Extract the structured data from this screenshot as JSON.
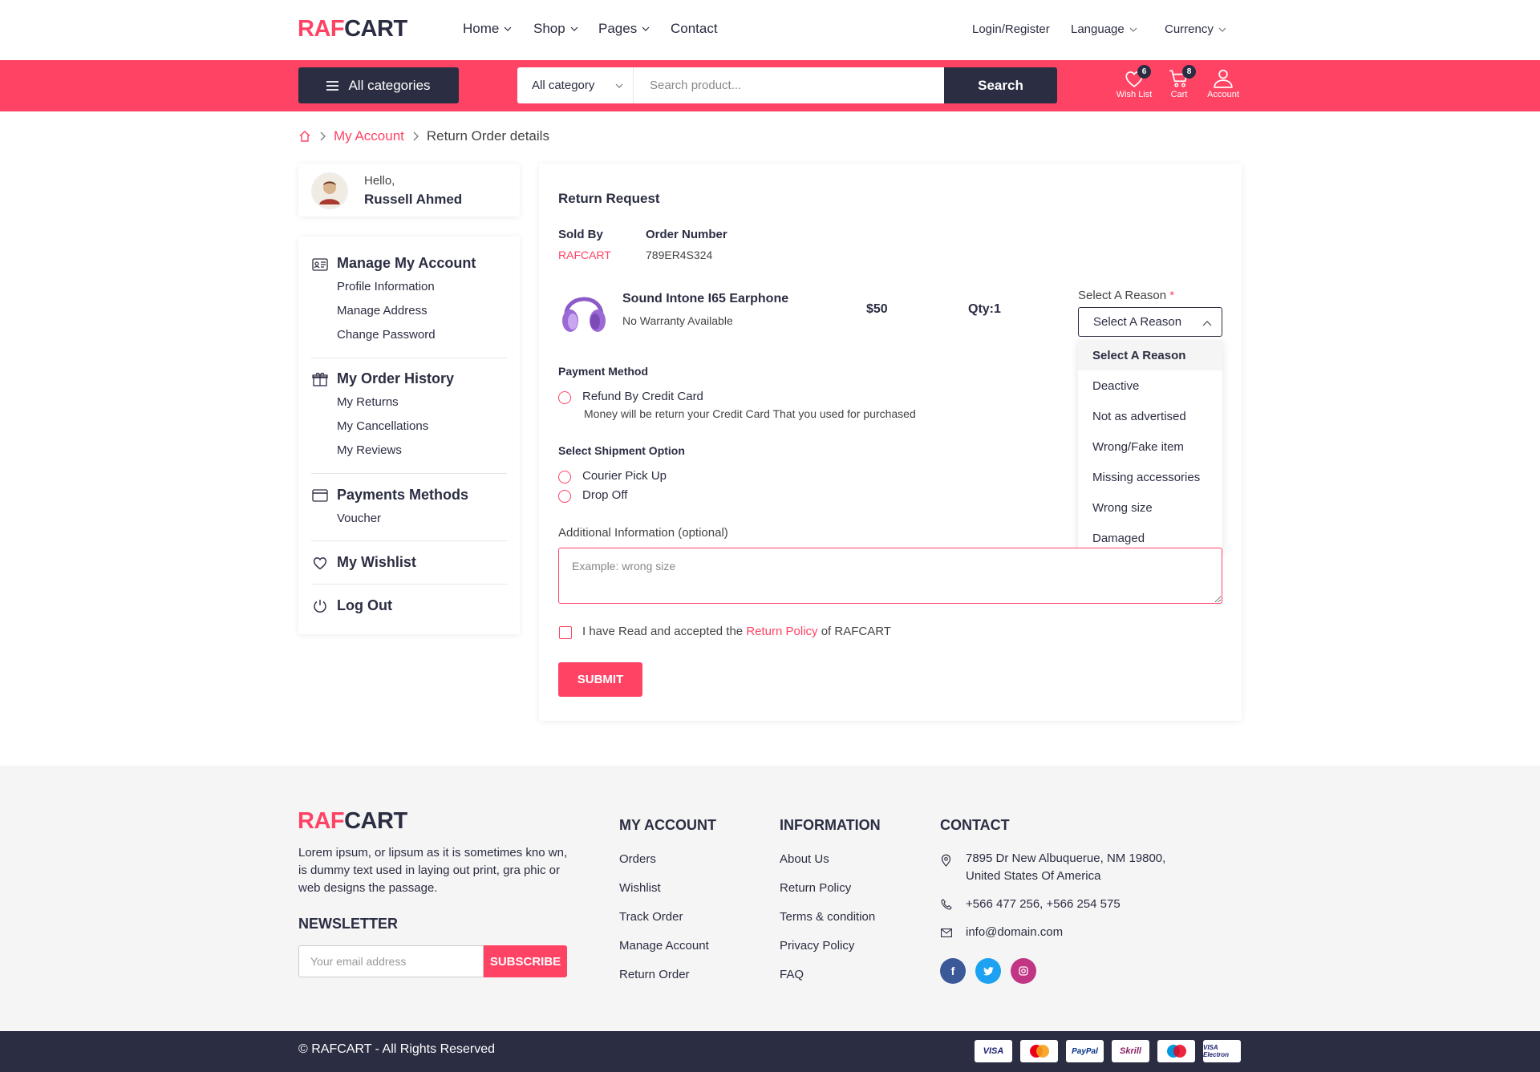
{
  "brand": {
    "part1": "RAF",
    "part2": "CART"
  },
  "nav": {
    "home": "Home",
    "shop": "Shop",
    "pages": "Pages",
    "contact": "Contact"
  },
  "util": {
    "login": "Login/Register",
    "language": "Language",
    "currency": "Currency"
  },
  "search": {
    "all_categories": "All categories",
    "category_select": "All category",
    "placeholder": "Search product...",
    "button": "Search"
  },
  "header_icons": {
    "wishlist": "Wish List",
    "wishlist_count": "6",
    "cart": "Cart",
    "cart_count": "8",
    "account": "Account"
  },
  "breadcrumb": {
    "parent": "My Account",
    "current": "Return Order details"
  },
  "profile": {
    "greeting": "Hello,",
    "name": "Russell Ahmed"
  },
  "sidebar": {
    "manage_account": "Manage My Account",
    "profile_info": "Profile Information",
    "manage_address": "Manage Address",
    "change_password": "Change Password",
    "order_history": "My Order History",
    "my_returns": "My Returns",
    "my_cancellations": "My Cancellations",
    "my_reviews": "My Reviews",
    "payments_methods": "Payments Methods",
    "voucher": "Voucher",
    "wishlist": "My Wishlist",
    "logout": "Log Out"
  },
  "return_request": {
    "title": "Return Request",
    "sold_by_label": "Sold By",
    "sold_by_value": "RAFCART",
    "order_number_label": "Order Number",
    "order_number_value": "789ER4S324",
    "product_name": "Sound Intone I65 Earphone",
    "warranty": "No Warranty Available",
    "price": "$50",
    "qty": "Qty:1",
    "reason_label": "Select A Reason",
    "reason_required": "*",
    "reason_selected": "Select A Reason",
    "reason_options": [
      "Select A Reason",
      "Deactive",
      "Not as advertised",
      "Wrong/Fake item",
      "Missing accessories",
      "Wrong size",
      "Damaged"
    ],
    "payment_method_label": "Payment Method",
    "refund_option": "Refund By Credit Card",
    "refund_note": "Money will be return your Credit Card That you used for purchased",
    "shipment_label": "Select Shipment Option",
    "courier": "Courier Pick Up",
    "drop_off": "Drop Off",
    "additional_label": "Additional Information (optional)",
    "additional_placeholder": "Example: wrong size",
    "policy_text_1": "I have Read and accepted the",
    "policy_link": "Return Policy",
    "policy_text_2": "of RAFCART",
    "submit": "SUBMIT"
  },
  "footer": {
    "about": "Lorem ipsum, or lipsum as it is sometimes kno wn, is dummy text used in laying out print, gra phic or web designs the passage.",
    "newsletter_title": "NEWSLETTER",
    "newsletter_placeholder": "Your email address",
    "subscribe": "SUBSCRIBE",
    "my_account_title": "MY ACCOUNT",
    "my_account_links": [
      "Orders",
      "Wishlist",
      "Track Order",
      "Manage Account",
      "Return Order"
    ],
    "information_title": "INFORMATION",
    "information_links": [
      "About Us",
      "Return Policy",
      "Terms & condition",
      "Privacy Policy",
      "FAQ"
    ],
    "contact_title": "CONTACT",
    "address_line1": "7895 Dr New Albuquerue, NM 19800,",
    "address_line2": "United States Of America",
    "phone": "+566 477 256, +566 254 575",
    "email": "info@domain.com",
    "copyright": "© RAFCART - All Rights Reserved",
    "payment_logos": [
      "VISA",
      "MasterCard",
      "PayPal",
      "Skrill",
      "Maestro",
      "VISA Electron"
    ]
  },
  "colors": {
    "accent": "#ff4364",
    "dark": "#2b2d42",
    "footer_bg": "#f5f5f5"
  }
}
